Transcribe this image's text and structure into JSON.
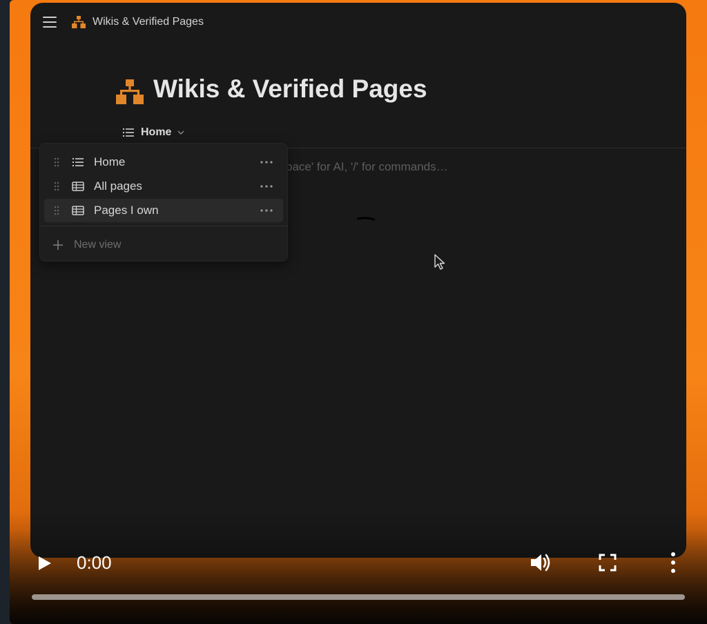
{
  "breadcrumb": {
    "title": "Wikis & Verified Pages",
    "icon": "sitemap-icon"
  },
  "page": {
    "title": "Wikis & Verified Pages",
    "icon": "sitemap-icon",
    "accent_color": "#e0862a",
    "current_view": "Home",
    "placeholder": "pace' for AI, '/' for commands…"
  },
  "view_menu": {
    "items": [
      {
        "label": "Home",
        "icon": "list-icon",
        "active": false
      },
      {
        "label": "All pages",
        "icon": "table-icon",
        "active": false
      },
      {
        "label": "Pages I own",
        "icon": "table-icon",
        "active": true
      }
    ],
    "new_view_label": "New view"
  },
  "video_player": {
    "time": "0:00",
    "progress": 0,
    "frame_color": "#f57a10"
  }
}
